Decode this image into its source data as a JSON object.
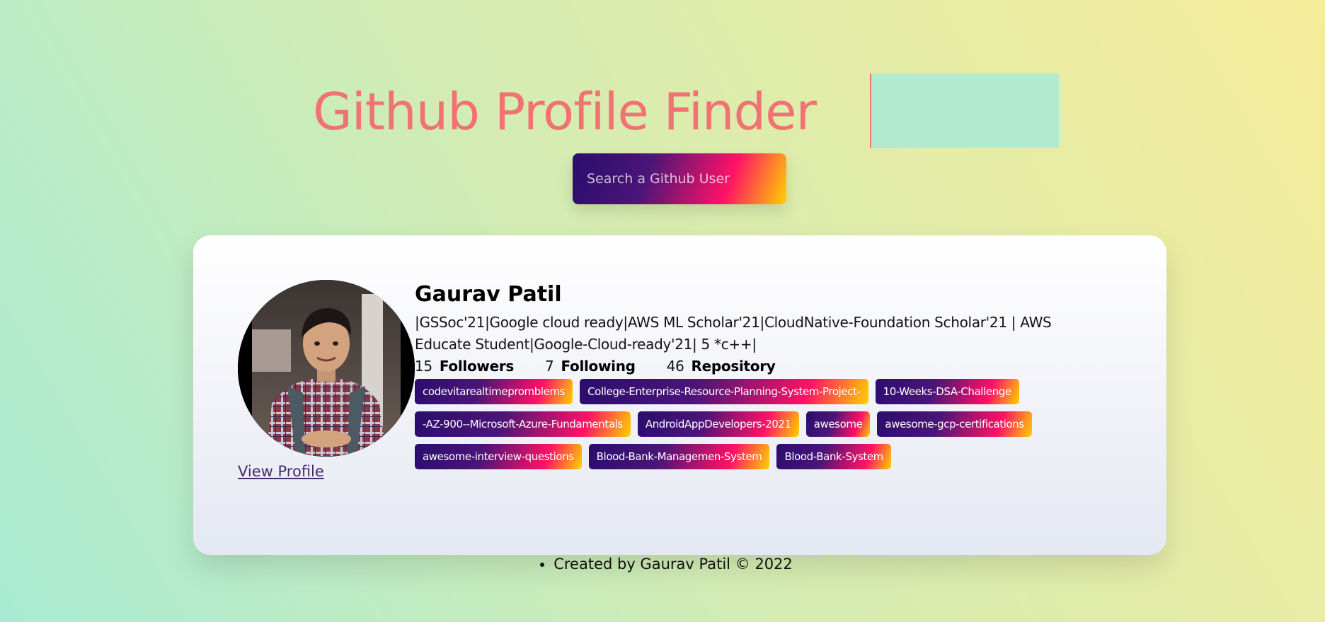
{
  "header": {
    "title": "Github Profile Finder"
  },
  "search": {
    "placeholder": "Search a Github User",
    "value": ""
  },
  "profile": {
    "name": "Gaurav Patil",
    "bio": "|GSSoc'21|Google cloud ready|AWS ML Scholar'21|CloudNative-Foundation Scholar'21 | AWS Educate Student|Google-Cloud-ready'21| 5 *c++|",
    "view_profile_label": "View Profile",
    "stats": {
      "followers_count": "15",
      "followers_label": "Followers",
      "following_count": "7",
      "following_label": "Following",
      "repos_count": "46",
      "repos_label": "Repository"
    },
    "repos": [
      "codevitarealtimepromblems",
      "College-Enterprise-Resource-Planning-System-Project-",
      "10-Weeks-DSA-Challenge",
      "-AZ-900--Microsoft-Azure-Fundamentals",
      "AndroidAppDevelopers-2021",
      "awesome",
      "awesome-gcp-certifications",
      "awesome-interview-questions",
      "Blood-Bank-Managemen-System",
      "Blood-Bank-System"
    ]
  },
  "footer": {
    "text": "Created by Gaurav Patil © 2022"
  },
  "colors": {
    "title": "#f07272",
    "gradient_start": "#2a0d6e",
    "gradient_mid": "#ff1266",
    "gradient_end": "#ffd200"
  }
}
